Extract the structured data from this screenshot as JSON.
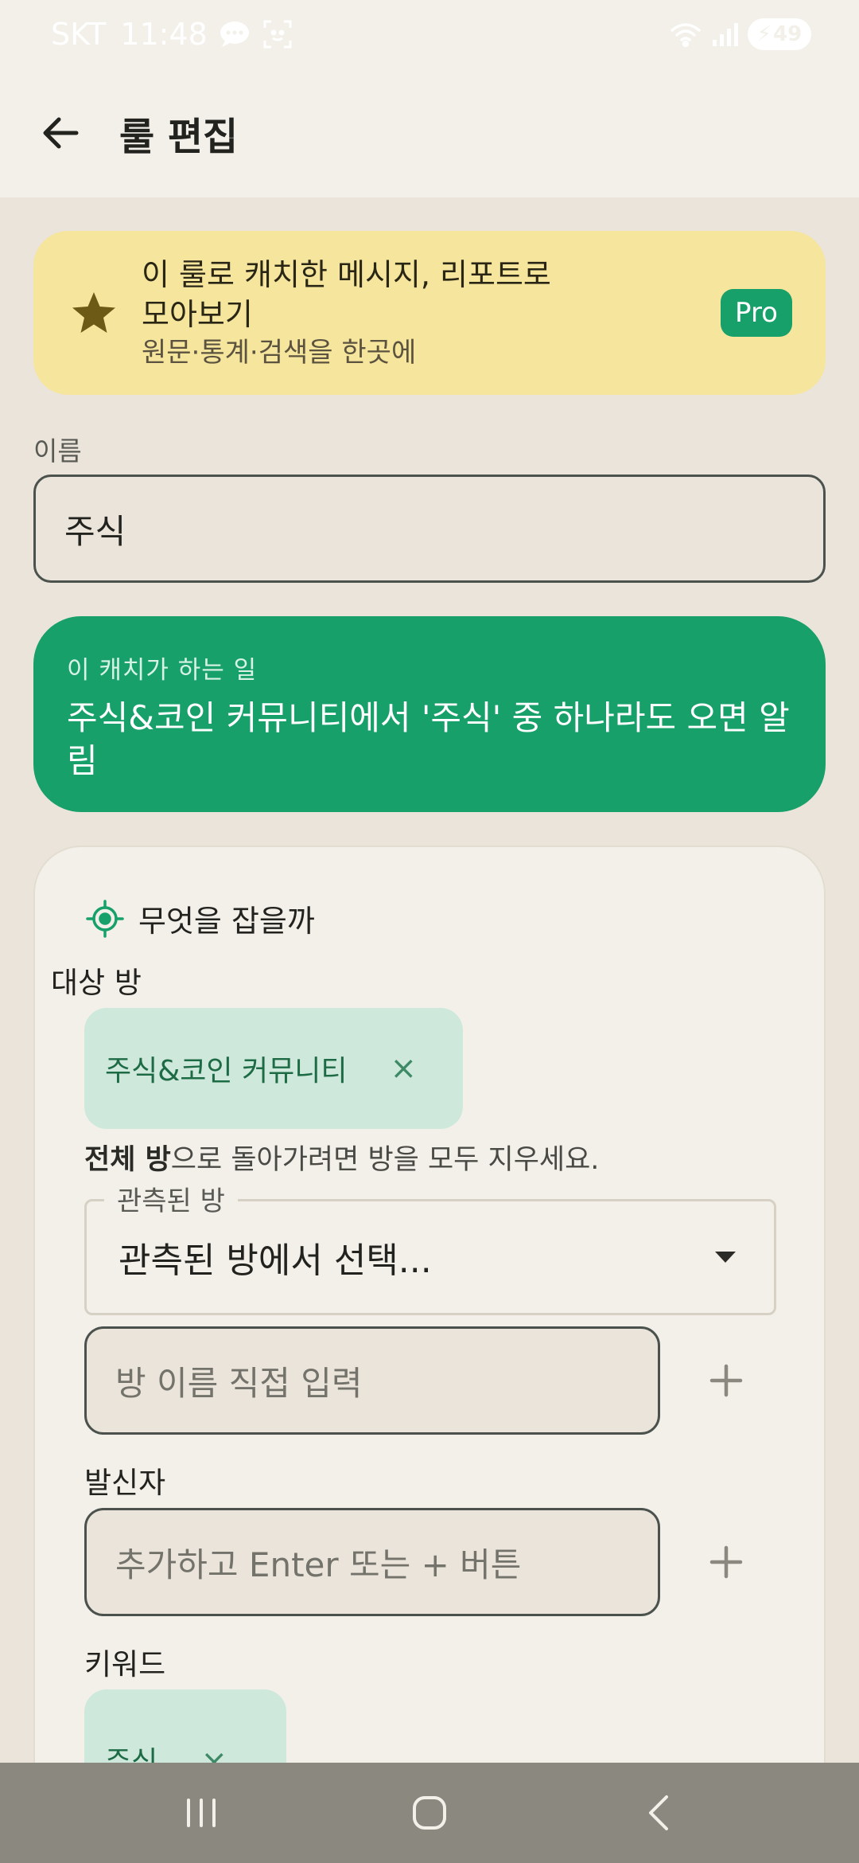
{
  "status_bar": {
    "carrier": "SKT",
    "time": "11:48",
    "battery_level": "49"
  },
  "app_bar": {
    "title": "룰 편집"
  },
  "promo": {
    "headline": "이 룰로 캐치한 메시지, 리포트로 모아보기",
    "subtext": "원문·통계·검색을 한곳에",
    "badge": "Pro",
    "colors": {
      "background": "#f6e59c",
      "badge": "#17a06a"
    }
  },
  "name_field": {
    "label": "이름",
    "value": "주식"
  },
  "summary": {
    "caption": "이 캐치가 하는 일",
    "description": "주식&코인 커뮤니티에서 '주식' 중 하나라도 오면 알림",
    "color": "#17a06a"
  },
  "what_to_catch": {
    "title": "무엇을 잡을까",
    "target_rooms": {
      "label": "대상 방",
      "chips": [
        {
          "label": "주식&코인 커뮤니티",
          "remove": "×"
        }
      ],
      "hint_bold": "전체 방",
      "hint_rest": "으로 돌아가려면 방을 모두 지우세요.",
      "observed_select": {
        "legend": "관측된 방",
        "value": "관측된 방에서 선택..."
      },
      "manual_input_placeholder": "방 이름 직접 입력"
    },
    "sender": {
      "label": "발신자",
      "input_placeholder": "추가하고 Enter 또는 + 버튼"
    },
    "keywords": {
      "label": "키워드",
      "chips": [
        {
          "label": "주식",
          "remove": "×"
        }
      ]
    }
  },
  "icons": [
    "back-arrow-icon",
    "star-icon",
    "target-icon",
    "plus-icon",
    "dropdown-arrow-icon",
    "recent-apps-icon",
    "home-icon",
    "nav-back-icon"
  ]
}
